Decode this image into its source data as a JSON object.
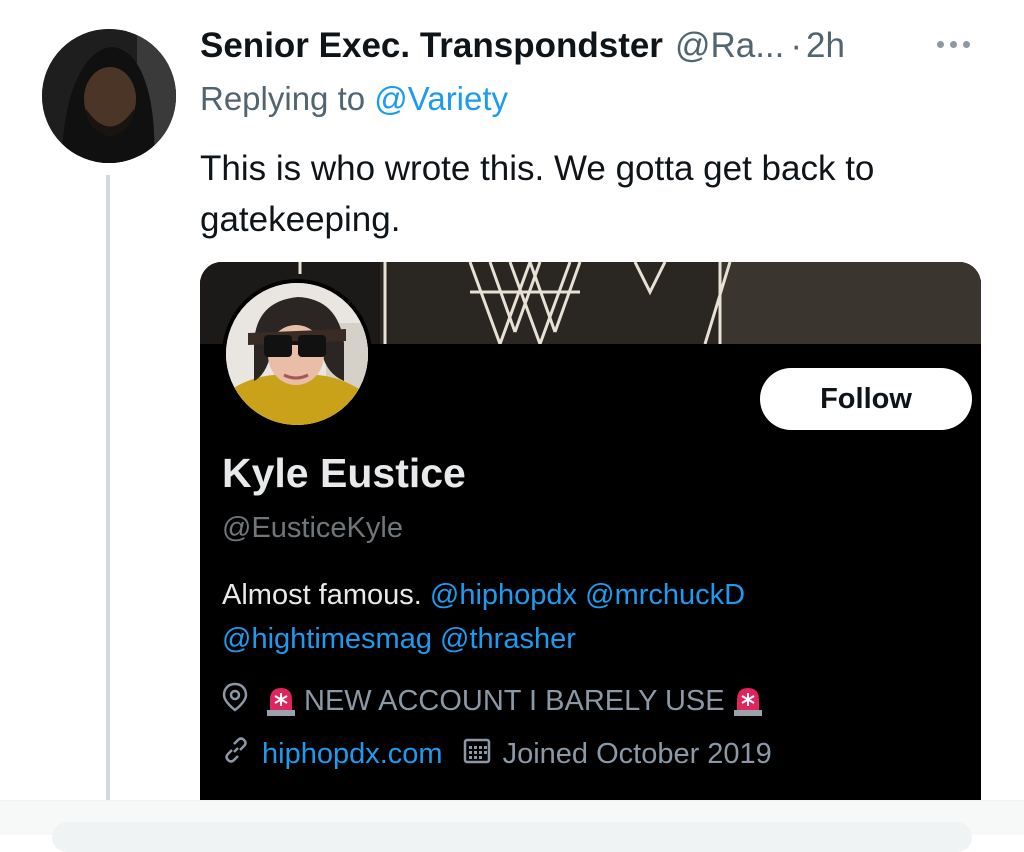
{
  "tweet": {
    "display_name": "Senior Exec. Transpondster",
    "handle": "@Ra...",
    "separator": "·",
    "time": "2h",
    "replying_prefix": "Replying to",
    "replying_to": "@Variety",
    "text": "This is who wrote this. We gotta get back to gatekeeping."
  },
  "profile_card": {
    "follow_label": "Follow",
    "name": "Kyle Eustice",
    "handle": "@EusticeKyle",
    "bio_text": "Almost famous.",
    "bio_mentions": [
      "@hiphopdx",
      "@mrchuckD",
      "@hightimesmag",
      "@thrasher"
    ],
    "location": "NEW ACCOUNT I BARELY USE",
    "website": "hiphopdx.com",
    "joined": "Joined October 2019"
  },
  "icons": {
    "more": "more-horizontal-icon",
    "location": "location-pin-icon",
    "siren": "siren-emoji-icon",
    "link": "link-icon",
    "calendar": "calendar-icon"
  },
  "colors": {
    "link": "#1d9bf0",
    "card_bg": "#000000",
    "secondary_text": "#536471"
  }
}
